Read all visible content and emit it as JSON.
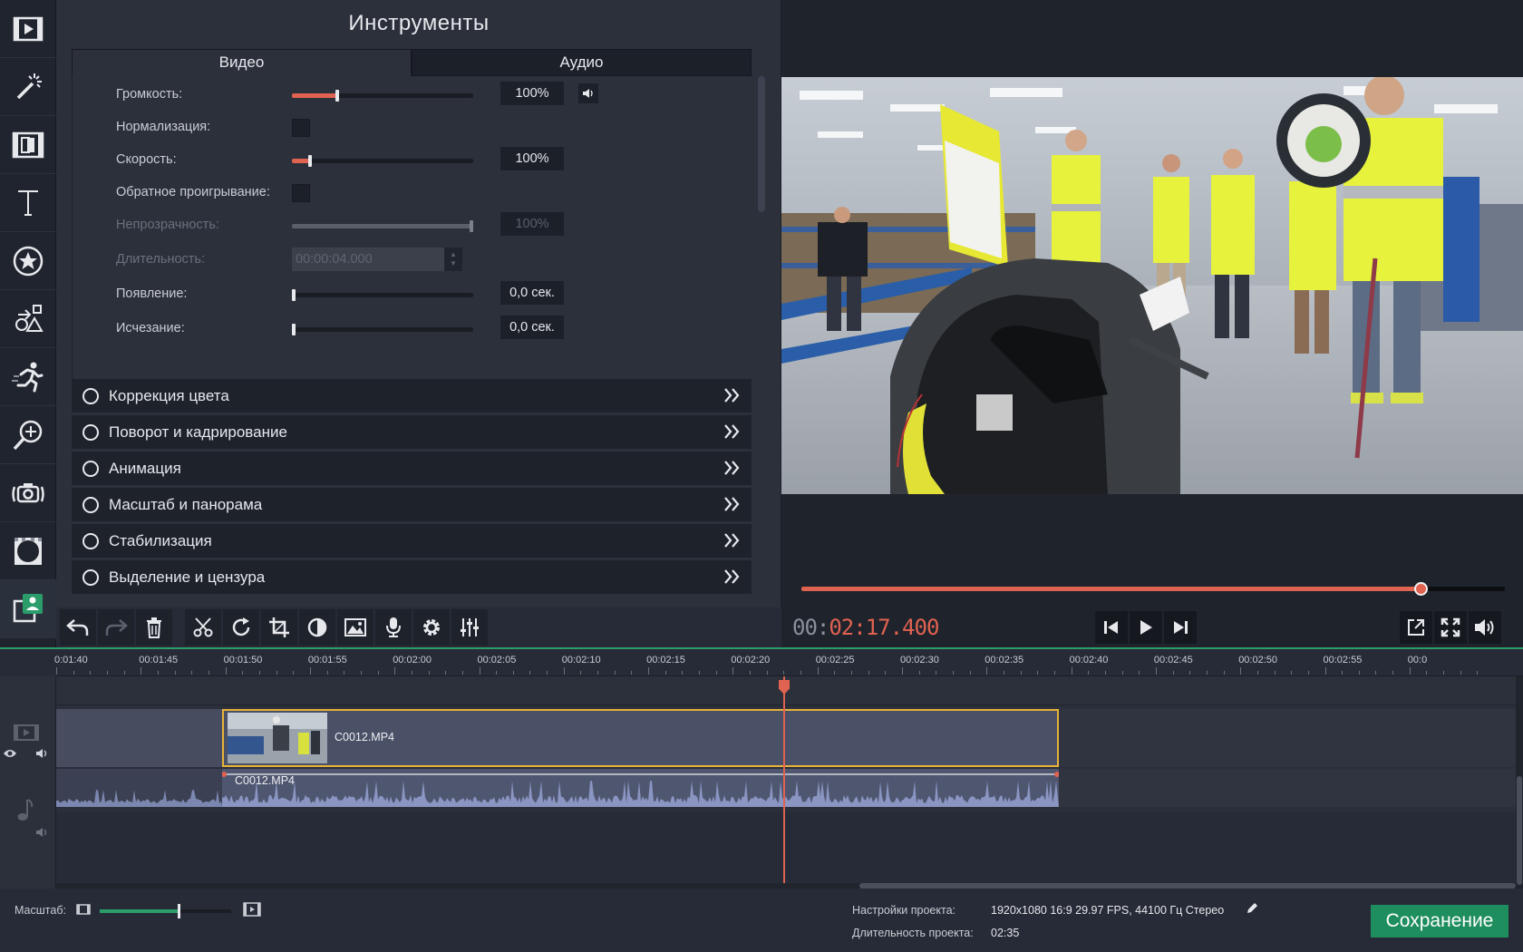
{
  "tools_panel": {
    "title": "Инструменты",
    "tabs": [
      {
        "label": "Видео",
        "active": true
      },
      {
        "label": "Аудио",
        "active": false
      }
    ],
    "properties": {
      "volume": {
        "label": "Громкость:",
        "value": "100%",
        "level": 0.25
      },
      "normalize": {
        "label": "Нормализация:",
        "checked": false
      },
      "speed": {
        "label": "Скорость:",
        "value": "100%",
        "level": 0.1
      },
      "reverse": {
        "label": "Обратное проигрывание:",
        "checked": false
      },
      "opacity": {
        "label": "Непрозрачность:",
        "value": "100%",
        "level": 1.0,
        "disabled": true
      },
      "duration": {
        "label": "Длительность:",
        "value": "00:00:04.000",
        "disabled": true
      },
      "fade_in": {
        "label": "Появление:",
        "value": "0,0 сек.",
        "level": 0.0
      },
      "fade_out": {
        "label": "Исчезание:",
        "value": "0,0 сек.",
        "level": 0.0
      }
    },
    "sections": [
      "Коррекция цвета",
      "Поворот и кадрирование",
      "Анимация",
      "Масштаб и панорама",
      "Стабилизация",
      "Выделение и цензура"
    ]
  },
  "left_toolbar": {
    "icons": [
      "import-icon",
      "magic-wand-icon",
      "transitions-icon",
      "titles-icon",
      "stickers-icon",
      "callouts-icon",
      "filters-icon",
      "zoom-icon",
      "camera-icon",
      "chroma-icon",
      "record-icon"
    ]
  },
  "preview": {
    "timecode_prefix": "00:",
    "timecode_current": "02:17.400",
    "progress": 0.88
  },
  "timeline": {
    "ruler_labels": [
      "0:01:40",
      "00:01:45",
      "00:01:50",
      "00:01:55",
      "00:02:00",
      "00:02:05",
      "00:02:10",
      "00:02:15",
      "00:02:20",
      "00:02:25",
      "00:02:30",
      "00:02:35",
      "00:02:40",
      "00:02:45",
      "00:02:50",
      "00:02:55",
      "00:0"
    ],
    "video_clip": "C0012.MP4",
    "audio_clip": "C0012.MP4"
  },
  "status": {
    "zoom_label": "Масштаб:",
    "zoom_level": 0.6,
    "project_settings_label": "Настройки проекта:",
    "project_settings_value": "1920x1080 16:9 29.97 FPS, 44100 Гц Стерео",
    "project_duration_label": "Длительность проекта:",
    "project_duration_value": "02:35",
    "save_label": "Сохранение"
  },
  "colors": {
    "accent": "#e06250",
    "save": "#1f8e5e",
    "clip_border": "#e8b23a",
    "timeline_top": "#2a9d6a"
  }
}
